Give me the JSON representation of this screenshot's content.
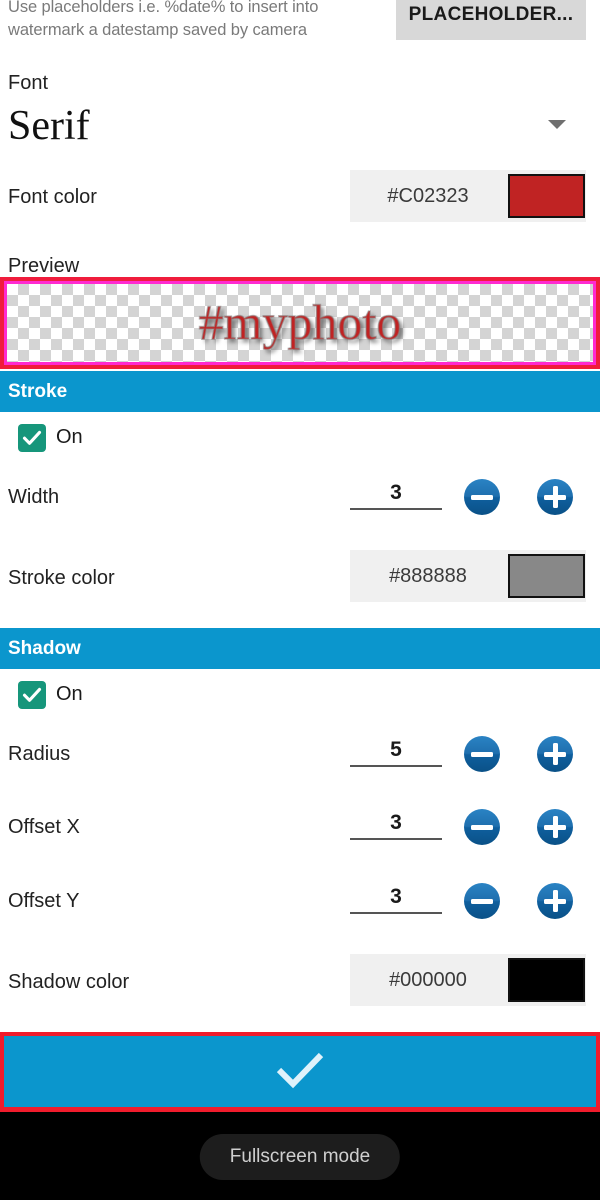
{
  "hint": {
    "text": "Use placeholders i.e. %date% to insert into watermark a datestamp saved by camera",
    "placeholder_button": "PLACEHOLDER..."
  },
  "font": {
    "label": "Font",
    "value": "Serif",
    "dropdown_icon": "chevron-down-icon"
  },
  "font_color": {
    "label": "Font color",
    "hex": "#C02323",
    "swatch": "#C02323"
  },
  "preview": {
    "label": "Preview",
    "watermark_text": "#myphoto",
    "text_color": "#C02323",
    "highlight_border": "#F01C3C",
    "inner_border": "#FF2AD0"
  },
  "stroke": {
    "header": "Stroke",
    "enabled_label": "On",
    "enabled": true,
    "width_label": "Width",
    "width_value": "3",
    "decrement_icon": "minus-circle-icon",
    "increment_icon": "plus-circle-icon",
    "color_label": "Stroke color",
    "color_hex": "#888888",
    "color_swatch": "#888888"
  },
  "shadow": {
    "header": "Shadow",
    "enabled_label": "On",
    "enabled": true,
    "radius_label": "Radius",
    "radius_value": "5",
    "offset_x_label": "Offset X",
    "offset_x_value": "3",
    "offset_y_label": "Offset Y",
    "offset_y_value": "3",
    "color_label": "Shadow color",
    "color_hex": "#000000",
    "color_swatch": "#000000"
  },
  "confirm": {
    "icon": "check-icon",
    "accent": "#0B96CD"
  },
  "bottom": {
    "toast_text": "Fullscreen mode"
  }
}
